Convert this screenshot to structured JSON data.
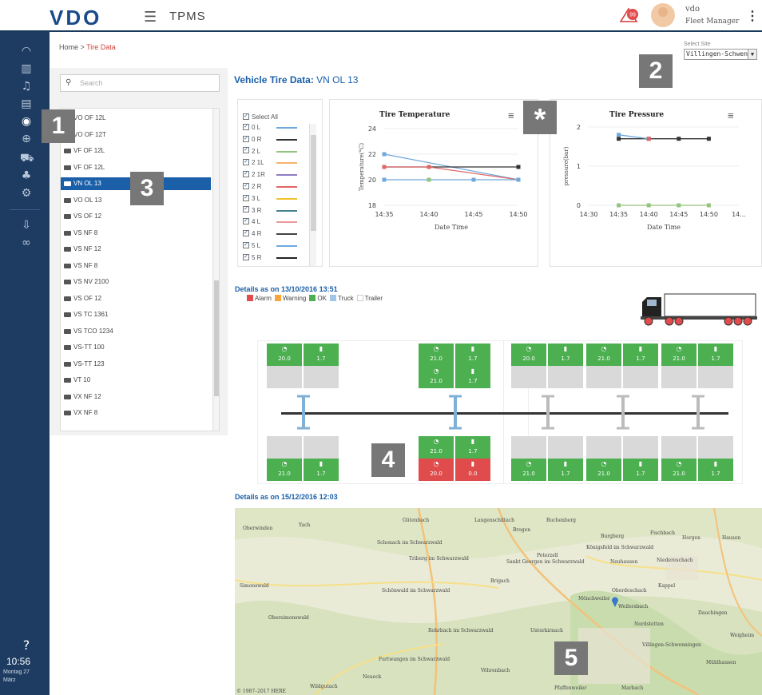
{
  "header": {
    "logo": "VDO",
    "app_title": "TPMS",
    "alarm_count": "99",
    "user_name": "vdo",
    "user_role": "Fleet Manager"
  },
  "breadcrumb": {
    "home": "Home",
    "sep": ">",
    "current": "Tire Data"
  },
  "site": {
    "label": "Select Site",
    "value": "Villingen-Schwenn"
  },
  "search": {
    "placeholder": "Search"
  },
  "vehicles": [
    {
      "label": "VO OF 12L",
      "selected": false
    },
    {
      "label": "VO OF 12T",
      "selected": false
    },
    {
      "label": "VF OF 12L",
      "selected": false
    },
    {
      "label": "VF OF 12L",
      "selected": false
    },
    {
      "label": "VN OL 13",
      "selected": true
    },
    {
      "label": "VO OL 13",
      "selected": false
    },
    {
      "label": "VS OF 12",
      "selected": false
    },
    {
      "label": "VS NF 8",
      "selected": false
    },
    {
      "label": "VS NF 12",
      "selected": false
    },
    {
      "label": "VS NF 8",
      "selected": false
    },
    {
      "label": "VS NV 2100",
      "selected": false
    },
    {
      "label": "VS OF 12",
      "selected": false
    },
    {
      "label": "VS TC 1361",
      "selected": false
    },
    {
      "label": "VS TCO 1234",
      "selected": false
    },
    {
      "label": "VS-TT 100",
      "selected": false
    },
    {
      "label": "VS-TT 123",
      "selected": false
    },
    {
      "label": "VT 10",
      "selected": false
    },
    {
      "label": "VX NF 12",
      "selected": false
    },
    {
      "label": "VX NF 8",
      "selected": false
    }
  ],
  "vehicle_title": {
    "prefix": "Vehicle Tire Data:",
    "name": "VN OL 13"
  },
  "tire_selector": {
    "select_all": "Select All",
    "tires": [
      {
        "label": "0 L",
        "color": "#6fa8dc"
      },
      {
        "label": "0 R",
        "color": "#333333"
      },
      {
        "label": "2 L",
        "color": "#93c47d"
      },
      {
        "label": "2 1L",
        "color": "#f6b26b"
      },
      {
        "label": "2 1R",
        "color": "#8e7cc3"
      },
      {
        "label": "2 R",
        "color": "#e06666"
      },
      {
        "label": "3 L",
        "color": "#f1c232"
      },
      {
        "label": "3 R",
        "color": "#45818e"
      },
      {
        "label": "4 L",
        "color": "#ea9999"
      },
      {
        "label": "4 R",
        "color": "#444444"
      },
      {
        "label": "5 L",
        "color": "#6fa8dc"
      },
      {
        "label": "5 R",
        "color": "#222222"
      }
    ]
  },
  "chart_data": [
    {
      "type": "line",
      "title": "Tire Temperature",
      "xlabel": "Date Time",
      "ylabel": "Temperature(°C)",
      "x_ticks": [
        "14:35",
        "14:40",
        "14:45",
        "14:50"
      ],
      "ylim": [
        18,
        24
      ],
      "y_ticks": [
        18,
        20,
        22,
        24
      ],
      "series": [
        {
          "color": "#6fa8dc",
          "x": [
            "14:35",
            "14:50"
          ],
          "values": [
            22,
            20
          ]
        },
        {
          "color": "#333333",
          "x": [
            "14:35",
            "14:40",
            "14:50"
          ],
          "values": [
            21,
            21,
            21
          ]
        },
        {
          "color": "#e06666",
          "x": [
            "14:35",
            "14:40",
            "14:50"
          ],
          "values": [
            21,
            21,
            20
          ]
        },
        {
          "color": "#6fa8dc",
          "x": [
            "14:35",
            "14:40",
            "14:45",
            "14:50"
          ],
          "values": [
            20,
            20,
            20,
            20
          ]
        },
        {
          "color": "#93c47d",
          "x": [
            "14:40"
          ],
          "values": [
            20
          ]
        }
      ]
    },
    {
      "type": "line",
      "title": "Tire Pressure",
      "xlabel": "Date Time",
      "ylabel": "pressure(bar)",
      "x_ticks": [
        "14:30",
        "14:35",
        "14:40",
        "14:45",
        "14:50",
        "14..."
      ],
      "ylim": [
        0,
        2
      ],
      "y_ticks": [
        0,
        1,
        2
      ],
      "series": [
        {
          "color": "#333333",
          "x": [
            "14:35",
            "14:40",
            "14:45",
            "14:50"
          ],
          "values": [
            1.7,
            1.7,
            1.7,
            1.7
          ]
        },
        {
          "color": "#6fa8dc",
          "x": [
            "14:35",
            "14:40"
          ],
          "values": [
            1.8,
            1.7
          ]
        },
        {
          "color": "#e06666",
          "x": [
            "14:40"
          ],
          "values": [
            1.7
          ]
        },
        {
          "color": "#93c47d",
          "x": [
            "14:35",
            "14:40",
            "14:45",
            "14:50"
          ],
          "values": [
            0,
            0,
            0,
            0
          ]
        }
      ]
    }
  ],
  "details1": {
    "label": "Details as on 13/10/2016 13:51"
  },
  "status_legend": [
    {
      "label": "Alarm",
      "color": "#e04b4b"
    },
    {
      "label": "Warning",
      "color": "#f6a53a"
    },
    {
      "label": "OK",
      "color": "#4caf50"
    },
    {
      "label": "Truck",
      "color": "#9fc5e8"
    },
    {
      "label": "Trailer",
      "color": "#ffffff"
    }
  ],
  "axle_cells": [
    {
      "v": "20.0",
      "k": "temp",
      "s": "green"
    },
    {
      "v": "1.7",
      "k": "pres",
      "s": "green"
    },
    {
      "v": "21.0",
      "k": "temp",
      "s": "green"
    },
    {
      "v": "1.7",
      "k": "pres",
      "s": "green"
    },
    {
      "v": "21.0",
      "k": "temp",
      "s": "green"
    },
    {
      "v": "1.7",
      "k": "pres",
      "s": "green"
    },
    {
      "v": "20.0",
      "k": "temp",
      "s": "green"
    },
    {
      "v": "1.7",
      "k": "pres",
      "s": "green"
    },
    {
      "v": "21.0",
      "k": "temp",
      "s": "green"
    },
    {
      "v": "1.7",
      "k": "pres",
      "s": "green"
    },
    {
      "v": "21.0",
      "k": "temp",
      "s": "green"
    },
    {
      "v": "1.7",
      "k": "pres",
      "s": "green"
    },
    {
      "v": "21.0",
      "k": "temp",
      "s": "green"
    },
    {
      "v": "1.7",
      "k": "pres",
      "s": "green"
    },
    {
      "v": "21.0",
      "k": "temp",
      "s": "green"
    },
    {
      "v": "1.7",
      "k": "pres",
      "s": "green"
    },
    {
      "v": "20.0",
      "k": "temp",
      "s": "red"
    },
    {
      "v": "0.0",
      "k": "pres",
      "s": "red"
    },
    {
      "v": "21.0",
      "k": "temp",
      "s": "green"
    },
    {
      "v": "1.7",
      "k": "pres",
      "s": "green"
    },
    {
      "v": "21.0",
      "k": "temp",
      "s": "green"
    },
    {
      "v": "1.7",
      "k": "pres",
      "s": "green"
    },
    {
      "v": "21.0",
      "k": "temp",
      "s": "green"
    },
    {
      "v": "1.7",
      "k": "pres",
      "s": "green"
    },
    {
      "v": "20.0",
      "k": "temp",
      "s": "green"
    },
    {
      "v": "1.7",
      "k": "pres",
      "s": "green"
    },
    {
      "v": "21.0",
      "k": "temp",
      "s": "green"
    },
    {
      "v": "1.7",
      "k": "pres",
      "s": "green"
    }
  ],
  "details2": {
    "label": "Details as on 15/12/2016 12:03"
  },
  "map_labels": [
    "Oberwinden",
    "Yach",
    "Gütenbach",
    "Langenschiltach",
    "Buchenberg",
    "Brogen",
    "Burgberg",
    "Fischbach",
    "Horgen",
    "Hausen",
    "Schonach im Schwarzwald",
    "Triberg im Schwarzwald",
    "Peterzell",
    "Königsfeld im Schwarzwald",
    "Neuhausen",
    "Niedereschach",
    "Sankt Georgen im Schwarzwald",
    "Brigach",
    "Simonswald",
    "Schönwald im Schwarzwald",
    "Mönchweiler",
    "Oberdeschach",
    "Kappel",
    "Obersimonswald",
    "Weilersbach",
    "Dauchingen",
    "Nordstetten",
    "Rohrbach im Schwarzwald",
    "Unterkirnach",
    "Villingen-Schwenningen",
    "Furtwangen im Schwarzwald",
    "Vöhrenbach",
    "Neueck",
    "Wildgutach",
    "Pfaffenweiler",
    "Marbach",
    "Mühlhausen",
    "Weigheim"
  ],
  "map_copyright": "© 1987–2017 HERE",
  "nav": {
    "clock": "10:56",
    "date_line1": "Montag 27",
    "date_line2": "März"
  },
  "callouts": [
    "1",
    "2",
    "3",
    "4",
    "5",
    "*"
  ]
}
